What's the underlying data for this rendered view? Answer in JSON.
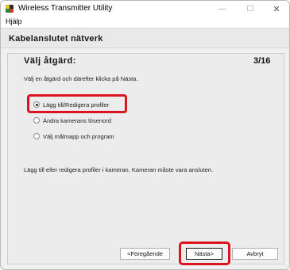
{
  "window": {
    "title": "Wireless Transmitter Utility",
    "controls": {
      "minimize": "—",
      "maximize": "☐",
      "close": "✕"
    }
  },
  "menu": {
    "items": [
      {
        "label": "Hjälp"
      }
    ]
  },
  "header": {
    "title": "Kabelanslutet nätverk"
  },
  "step": {
    "title": "Välj åtgärd:",
    "counter": "3/16",
    "instruction": "Välj en åtgärd och därefter klicka på Nästa."
  },
  "options": [
    {
      "label": "Lägg till/Redigera profiler",
      "selected": true
    },
    {
      "label": "Ändra kamerans lösenord",
      "selected": false
    },
    {
      "label": "Välj målmapp och program",
      "selected": false
    }
  ],
  "description": "Lägg till eller redigera profiler i kameran. Kameran måste vara ansluten.",
  "buttons": {
    "previous": "<Föregående",
    "next": "Nästa>",
    "cancel": "Avbryt"
  },
  "colors": {
    "highlight": "#d9141f"
  },
  "icons": {
    "app": "wireless-transmitter-app-icon"
  }
}
